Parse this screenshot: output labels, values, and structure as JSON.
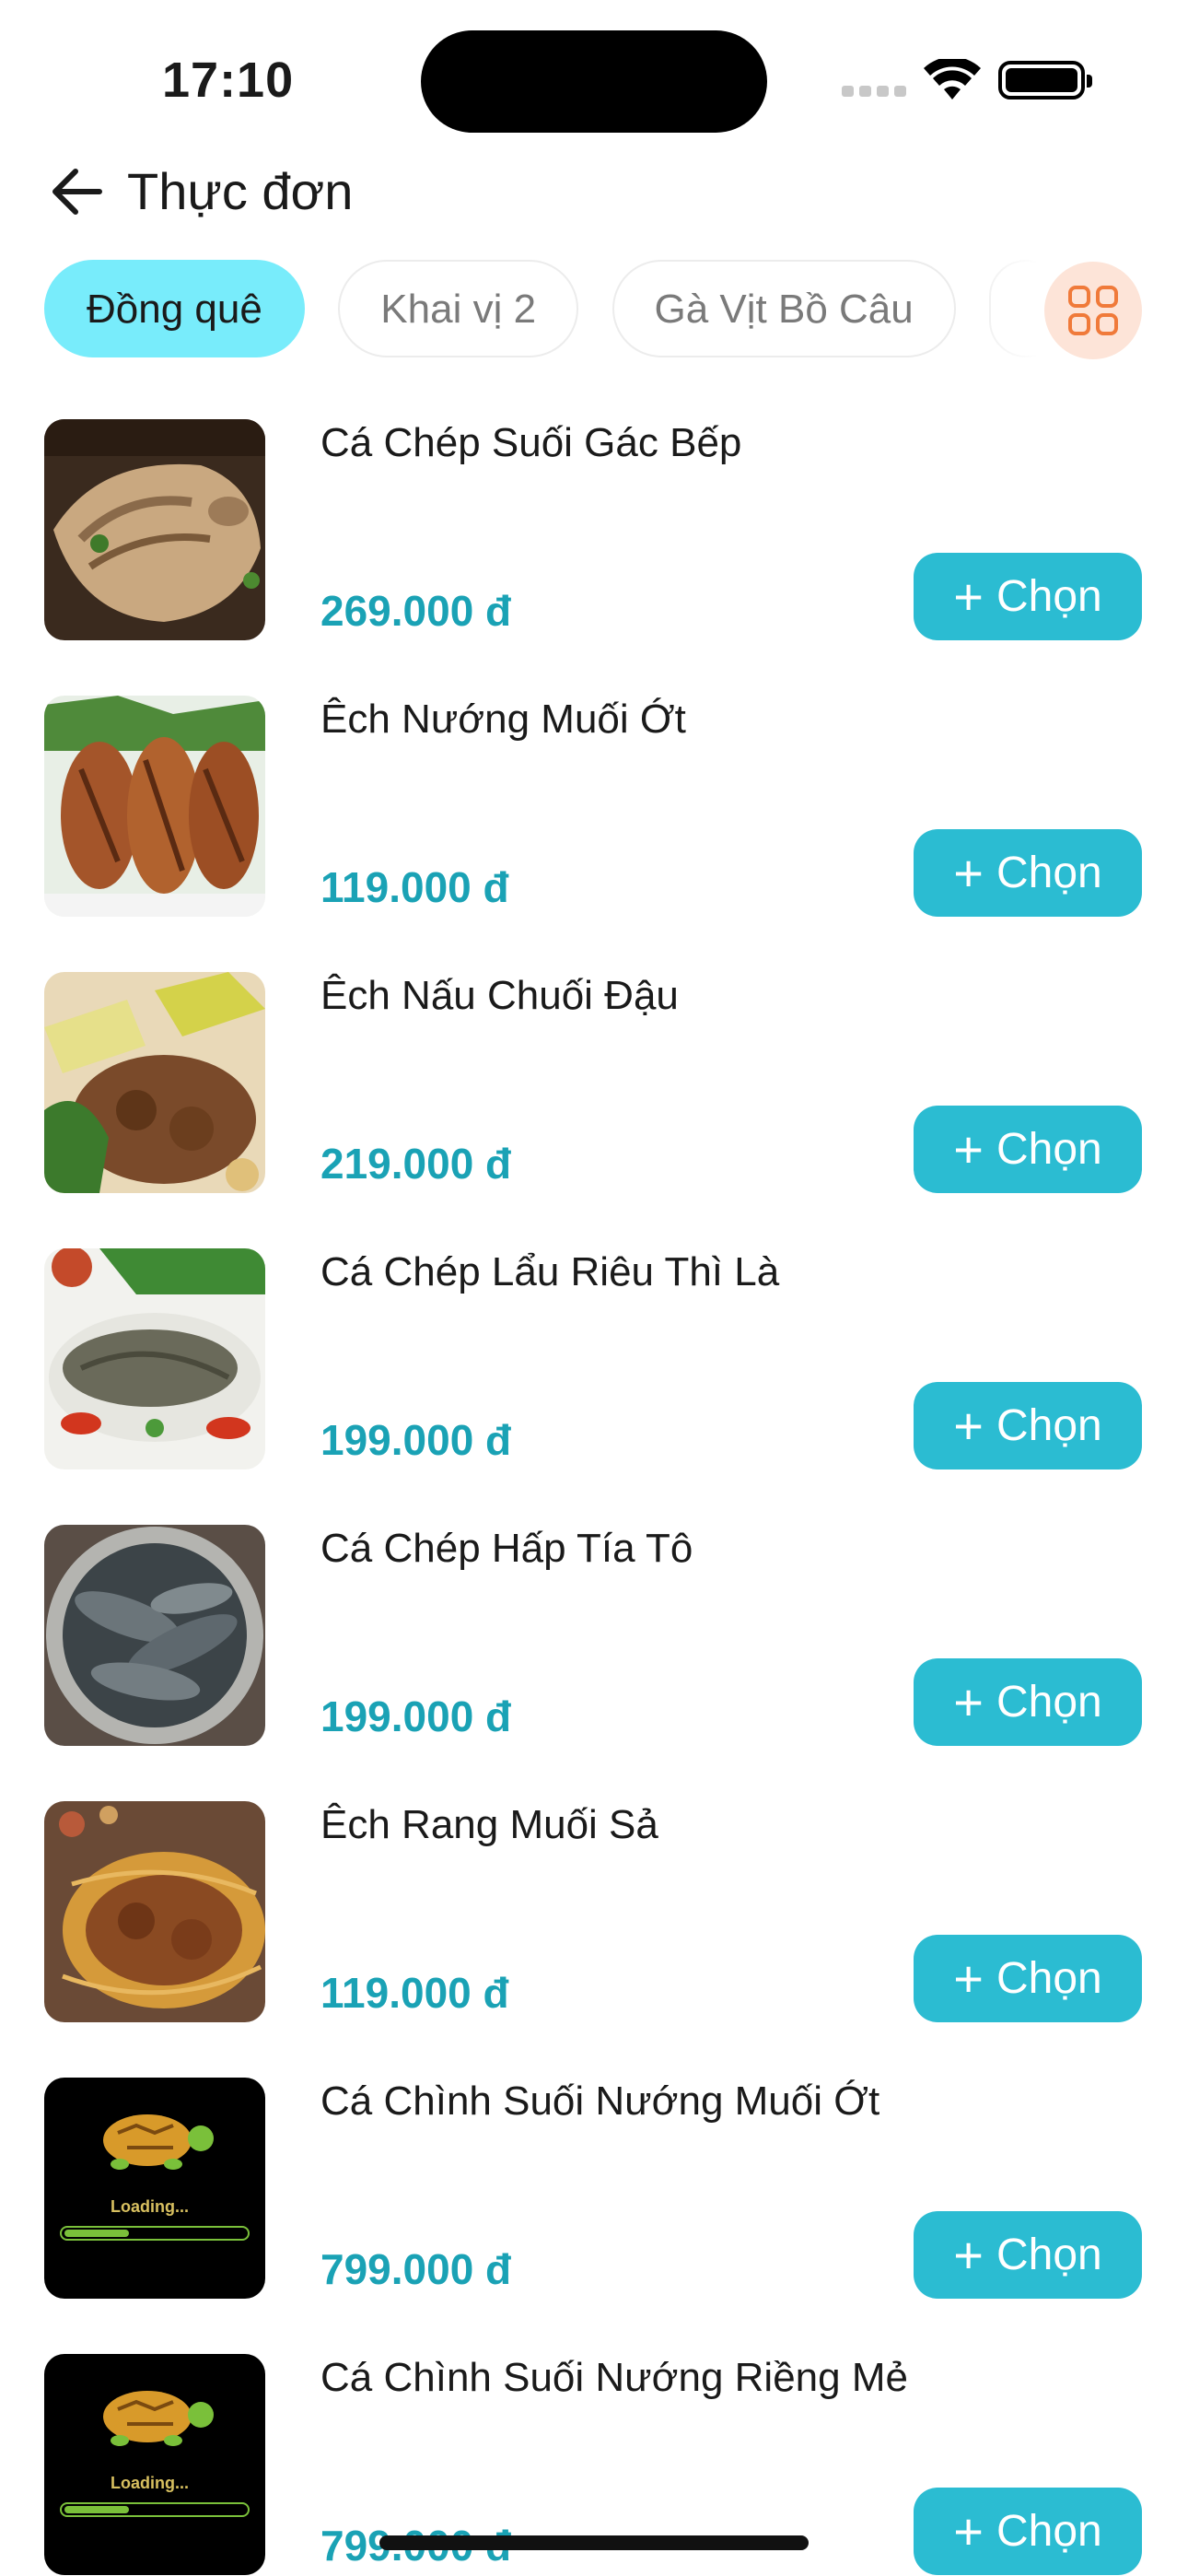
{
  "status_bar": {
    "time": "17:10"
  },
  "header": {
    "title": "Thực đơn",
    "back_icon": "arrow-left-icon"
  },
  "tabs": [
    {
      "label": "Đồng quê",
      "active": true
    },
    {
      "label": "Khai vị 2",
      "active": false
    },
    {
      "label": "Gà Vịt Bồ Câu",
      "active": false
    }
  ],
  "grid_button": {
    "icon": "grid-icon",
    "color": "#f07a3a"
  },
  "colors": {
    "accent": "#2bbcd2",
    "price": "#1aa2b5",
    "active_tab": "#78ecfb"
  },
  "menu": {
    "button_label": "Chọn",
    "button_icon": "plus-icon",
    "items": [
      {
        "name": "Cá Chép Suối Gác Bếp",
        "price": "269.000 đ",
        "image": "grilled-carp-image"
      },
      {
        "name": "Êch Nướng Muối Ớt",
        "price": "119.000 đ",
        "image": "grilled-frog-image"
      },
      {
        "name": "Êch Nấu Chuối Đậu",
        "price": "219.000 đ",
        "image": "frog-stew-image"
      },
      {
        "name": "Cá Chép Lẩu Riêu Thì Là",
        "price": "199.000 đ",
        "image": "carp-hotpot-image"
      },
      {
        "name": "Cá Chép Hấp Tía Tô",
        "price": "199.000 đ",
        "image": "steamed-carp-image"
      },
      {
        "name": "Êch Rang Muối Sả",
        "price": "119.000 đ",
        "image": "fried-frog-image"
      },
      {
        "name": "Cá Chình Suối Nướng Muối Ớt",
        "price": "799.000 đ",
        "image": "loading-turtle-image",
        "loading_text": "Loading..."
      },
      {
        "name": "Cá Chình Suối Nướng Riềng Mẻ",
        "price": "799.000 đ",
        "image": "loading-turtle-image",
        "loading_text": "Loading..."
      }
    ]
  }
}
